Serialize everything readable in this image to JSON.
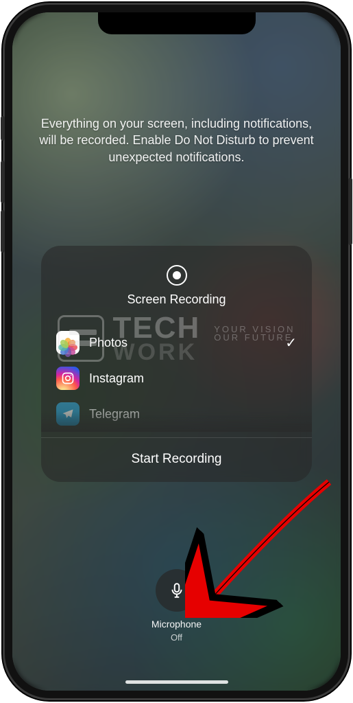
{
  "info_text": "Everything on your screen, including notifications, will be recorded. Enable Do Not Disturb to prevent unexpected notifications.",
  "panel": {
    "title": "Screen Recording",
    "apps": [
      {
        "name": "Photos",
        "icon": "photos-icon",
        "selected": true
      },
      {
        "name": "Instagram",
        "icon": "instagram-icon",
        "selected": false
      },
      {
        "name": "Telegram",
        "icon": "telegram-icon",
        "selected": false
      }
    ],
    "start_label": "Start Recording"
  },
  "microphone": {
    "label": "Microphone",
    "status": "Off"
  },
  "watermark": {
    "line1": "TECH",
    "line2": "WORK",
    "tag1": "YOUR VISION",
    "tag2": "OUR FUTURE"
  }
}
